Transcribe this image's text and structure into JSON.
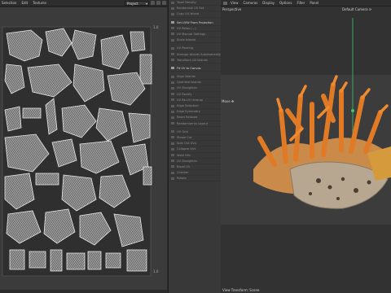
{
  "uv_menu": {
    "items": [
      "Selection",
      "Edit",
      "Textures"
    ]
  },
  "project_select": {
    "value": "Project"
  },
  "tools_panel": {
    "group1": [
      "Texel Density",
      "Randomize UV Set",
      "Copy UV Island"
    ],
    "group2": [
      "Set UVW From Projection",
      "UV Relax (...)",
      "UV Manual Settings",
      "Scale Islands"
    ],
    "group3": [
      "UV Packing",
      "Arrange Islands Automatically",
      "Transform UV Islands"
    ],
    "group4": [
      "Fit UV to Canvas"
    ],
    "group5": [
      "Align Islands",
      "Quantize Islands",
      "UV Straighten",
      "UV Rectify",
      "UV Re-UV Unwrap",
      "Edge Selection",
      "Edge Symmetry",
      "Reset Relaxed",
      "Randomize to Layout"
    ],
    "group6": [
      "UV Grid",
      "Shape Cut",
      "Split Out UVs",
      "Collapse UVs",
      "Weld UVs",
      "UV Straighten",
      "Bevel UV",
      "Checker",
      "Rotate"
    ]
  },
  "viewport_menu": {
    "items": [
      "View",
      "Cameras",
      "Display",
      "Options",
      "Filter",
      "Panel"
    ]
  },
  "viewport": {
    "perspective": "Perspective",
    "camera": "Default Camera ⟳",
    "move": "Move ✥",
    "status": "View Transform: Scene"
  },
  "uv_markers": {
    "top_right": "1,0",
    "bottom_right": "1,0"
  },
  "colors": {
    "accent": "#4a8fd6",
    "coral": "#e07a24",
    "rock": "#b8a790",
    "axis_green": "#3ec46d"
  }
}
